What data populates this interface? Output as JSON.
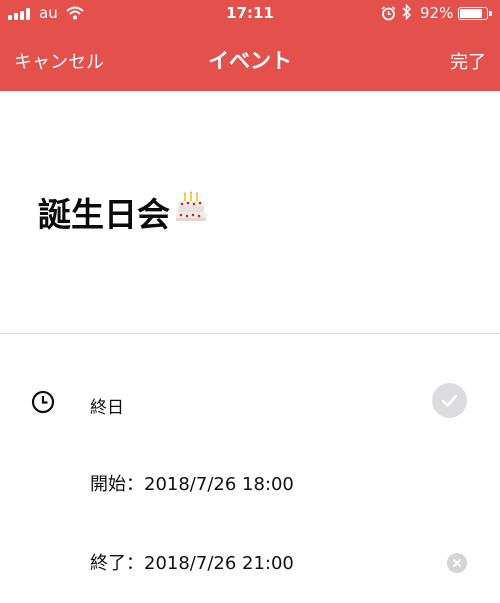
{
  "status_bar": {
    "carrier": "au",
    "time": "17:11",
    "battery_percent": "92%",
    "battery_level": 0.92,
    "icons": [
      "signal-icon",
      "wifi-icon",
      "alarm-icon",
      "bluetooth-icon",
      "battery-icon"
    ]
  },
  "nav": {
    "cancel_label": "キャンセル",
    "title": "イベント",
    "done_label": "完了"
  },
  "event": {
    "title": "誕生日会",
    "title_icon": "cake-icon"
  },
  "details": {
    "all_day_label": "終日",
    "all_day_checked": false,
    "start_label": "開始：",
    "start_value": "2018/7/26 18:00",
    "end_label": "終了：",
    "end_value": "2018/7/26 21:00"
  },
  "colors": {
    "header": "#e4504b",
    "toggle": "#dcdcdf"
  }
}
